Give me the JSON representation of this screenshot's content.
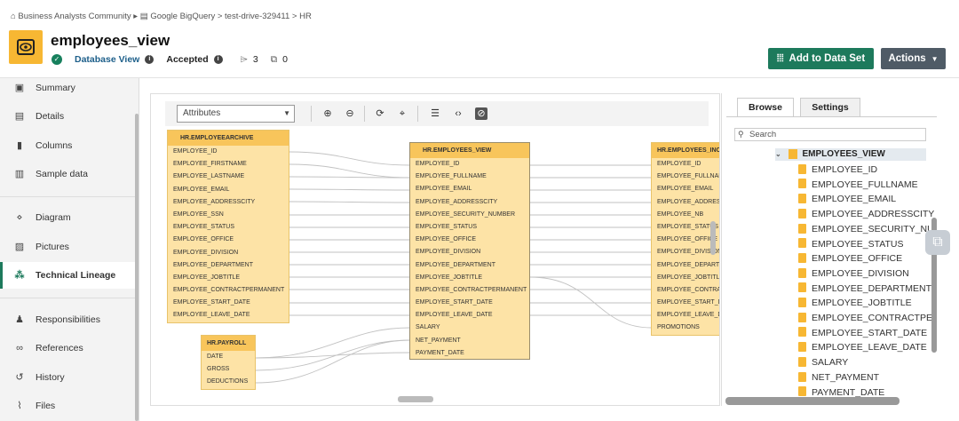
{
  "breadcrumb": {
    "community": "Business Analysts Community",
    "path": "Google BigQuery > test-drive-329411 > HR"
  },
  "asset": {
    "title": "employees_view",
    "type": "Database View",
    "status": "Accepted",
    "tag_count": "3",
    "comment_count": "0"
  },
  "actions": {
    "add_label": "Add to Data Set",
    "actions_label": "Actions"
  },
  "sidebar": {
    "items": [
      {
        "label": "Summary",
        "icon": "clipboard-icon"
      },
      {
        "label": "Details",
        "icon": "document-icon"
      },
      {
        "label": "Columns",
        "icon": "columns-icon"
      },
      {
        "label": "Sample data",
        "icon": "sample-data-icon"
      },
      {
        "label": "Diagram",
        "icon": "diagram-icon"
      },
      {
        "label": "Pictures",
        "icon": "pictures-icon"
      },
      {
        "label": "Technical Lineage",
        "icon": "lineage-icon"
      },
      {
        "label": "Responsibilities",
        "icon": "people-icon"
      },
      {
        "label": "References",
        "icon": "references-icon"
      },
      {
        "label": "History",
        "icon": "history-icon"
      },
      {
        "label": "Files",
        "icon": "paperclip-icon"
      }
    ],
    "active": "Technical Lineage"
  },
  "toolbar": {
    "dropdown_value": "Attributes"
  },
  "lineage": {
    "archive": {
      "title": "HR.EMPLOYEEARCHIVE",
      "rows": [
        "EMPLOYEE_ID",
        "EMPLOYEE_FIRSTNAME",
        "EMPLOYEE_LASTNAME",
        "EMPLOYEE_EMAIL",
        "EMPLOYEE_ADDRESSCITY",
        "EMPLOYEE_SSN",
        "EMPLOYEE_STATUS",
        "EMPLOYEE_OFFICE",
        "EMPLOYEE_DIVISION",
        "EMPLOYEE_DEPARTMENT",
        "EMPLOYEE_JOBTITLE",
        "EMPLOYEE_CONTRACTPERMANENT",
        "EMPLOYEE_START_DATE",
        "EMPLOYEE_LEAVE_DATE"
      ]
    },
    "payroll": {
      "title": "HR.PAYROLL",
      "rows": [
        "DATE",
        "GROSS",
        "DEDUCTIONS"
      ]
    },
    "view": {
      "title": "HR.EMPLOYEES_VIEW",
      "rows": [
        "EMPLOYEE_ID",
        "EMPLOYEE_FULLNAME",
        "EMPLOYEE_EMAIL",
        "EMPLOYEE_ADDRESSCITY",
        "EMPLOYEE_SECURITY_NUMBER",
        "EMPLOYEE_STATUS",
        "EMPLOYEE_OFFICE",
        "EMPLOYEE_DIVISION",
        "EMPLOYEE_DEPARTMENT",
        "EMPLOYEE_JOBTITLE",
        "EMPLOYEE_CONTRACTPERMANENT",
        "EMPLOYEE_START_DATE",
        "EMPLOYEE_LEAVE_DATE",
        "SALARY",
        "NET_PAYMENT",
        "PAYMENT_DATE"
      ]
    },
    "incoming": {
      "title": "HR.EMPLOYEES_INCO",
      "rows": [
        "EMPLOYEE_ID",
        "EMPLOYEE_FULLNAME",
        "EMPLOYEE_EMAIL",
        "EMPLOYEE_ADDRESSCITY",
        "EMPLOYEE_NB",
        "EMPLOYEE_STATUS",
        "EMPLOYEE_OFFICE",
        "EMPLOYEE_DIVISION",
        "EMPLOYEE_DEPARTME",
        "EMPLOYEE_JOBTITLE",
        "EMPLOYEE_CONTRACT",
        "EMPLOYEE_START_DA",
        "EMPLOYEE_LEAVE_DA",
        "PROMOTIONS"
      ]
    }
  },
  "panel": {
    "tabs": [
      "Browse",
      "Settings"
    ],
    "search_placeholder": "Search",
    "root": "EMPLOYEES_VIEW",
    "fields": [
      "EMPLOYEE_ID",
      "EMPLOYEE_FULLNAME",
      "EMPLOYEE_EMAIL",
      "EMPLOYEE_ADDRESSCITY",
      "EMPLOYEE_SECURITY_NUM",
      "EMPLOYEE_STATUS",
      "EMPLOYEE_OFFICE",
      "EMPLOYEE_DIVISION",
      "EMPLOYEE_DEPARTMENT",
      "EMPLOYEE_JOBTITLE",
      "EMPLOYEE_CONTRACTPERM",
      "EMPLOYEE_START_DATE",
      "EMPLOYEE_LEAVE_DATE",
      "SALARY",
      "NET_PAYMENT",
      "PAYMENT_DATE"
    ]
  }
}
